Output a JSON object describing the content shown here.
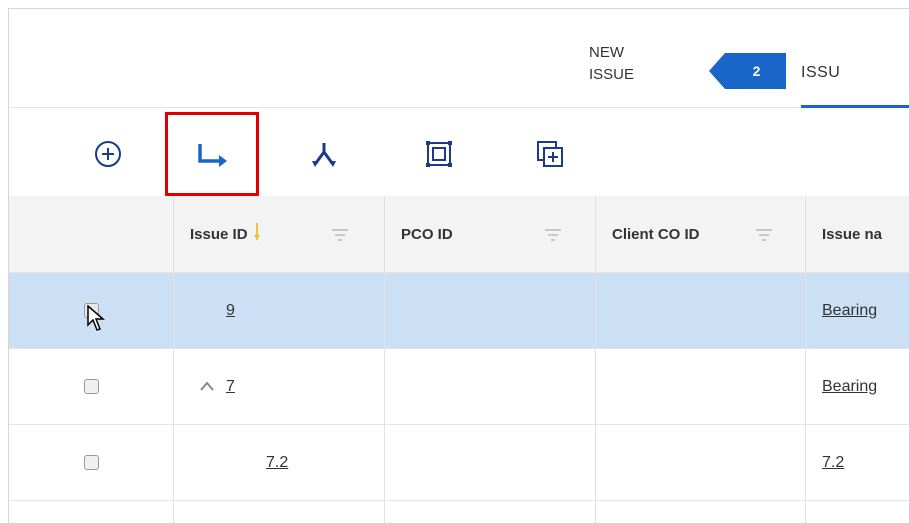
{
  "topbar": {
    "new_issue_line1": "NEW",
    "new_issue_line2": "ISSUE",
    "badge_count": "2",
    "tab_issues": "ISSU",
    "accent_color": "#1a66c8"
  },
  "toolbar": {
    "tools": [
      "add-circle-icon",
      "link-arrow-icon",
      "merge-icon",
      "frame-icon",
      "duplicate-icon"
    ],
    "highlight_color": "#e00000"
  },
  "table": {
    "columns": [
      "Issue ID",
      "PCO ID",
      "Client CO ID",
      "Issue na"
    ],
    "rows": [
      {
        "issue_id": "9",
        "pco_id": "",
        "client_co_id": "",
        "issue_name": "Bearing",
        "selected": true
      },
      {
        "issue_id": "7",
        "pco_id": "",
        "client_co_id": "",
        "issue_name": "Bearing",
        "expanded": true
      },
      {
        "issue_id": "7.2",
        "pco_id": "",
        "client_co_id": "",
        "issue_name": "7.2"
      }
    ]
  }
}
